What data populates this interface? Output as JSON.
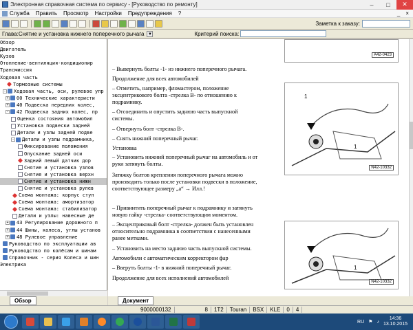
{
  "window": {
    "title": "Электронная справочная система по сервису - [Руководство по ремонту]"
  },
  "menu": {
    "items": [
      "Служба",
      "Править",
      "Просмотр",
      "Настройки",
      "Предупреждения",
      "?"
    ],
    "right": [
      "_",
      "×"
    ]
  },
  "toolbar": {
    "order_label": "Заметка к заказу:"
  },
  "chapter": {
    "label": "Глава:",
    "value": "Снятие и установка нижнего поперечного рычага",
    "criteria_label": "Критерий поиска:"
  },
  "tree": [
    {
      "text": "Обзор",
      "icon": "none",
      "exp": ""
    },
    {
      "text": "Двигатель",
      "icon": "none",
      "exp": ""
    },
    {
      "text": "Кузов",
      "icon": "none",
      "exp": ""
    },
    {
      "text": "Отопление-вентиляция-кондиционир",
      "icon": "none",
      "exp": ""
    },
    {
      "text": "Трансмиссия",
      "icon": "none",
      "exp": ""
    },
    {
      "text": "Ходовая часть",
      "icon": "none",
      "exp": ""
    },
    {
      "text": "Тормозные системы",
      "icon": "diamond",
      "exp": ""
    },
    {
      "text": "Ходовая часть, оси, рулевое упр",
      "icon": "book",
      "exp": "-"
    },
    {
      "text": "00 Технические характеристи",
      "icon": "book",
      "exp": "+"
    },
    {
      "text": "40 Подвеска передних колес,",
      "icon": "book",
      "exp": "+"
    },
    {
      "text": "42 Подвеска задних колес, пр",
      "icon": "book",
      "exp": "-"
    },
    {
      "text": "Оценка состояния автомобил",
      "icon": "page",
      "exp": ""
    },
    {
      "text": "Установка подвески задней",
      "icon": "page",
      "exp": ""
    },
    {
      "text": "Детали и узлы задней подве",
      "icon": "page",
      "exp": ""
    },
    {
      "text": "Детали и узлы подрамника,",
      "icon": "book",
      "exp": "-"
    },
    {
      "text": "Фиксирование положения",
      "icon": "page",
      "exp": ""
    },
    {
      "text": "Опускание задней оси",
      "icon": "page",
      "exp": ""
    },
    {
      "text": "Задний левый датчик дор",
      "icon": "diamond",
      "exp": ""
    },
    {
      "text": "Снятие и установка узлов",
      "icon": "page",
      "exp": ""
    },
    {
      "text": "Снятие и установка верхн",
      "icon": "page",
      "exp": ""
    },
    {
      "text": "Снятие и установка нижн",
      "icon": "page",
      "exp": "",
      "selected": true
    },
    {
      "text": "Снятие и установка рулев",
      "icon": "page",
      "exp": ""
    },
    {
      "text": "Схема монтажа: корпус ступ",
      "icon": "diamond",
      "exp": ""
    },
    {
      "text": "Схема монтажа: амортизатор",
      "icon": "diamond",
      "exp": ""
    },
    {
      "text": "Схема монтажа: стабилизатор",
      "icon": "diamond",
      "exp": ""
    },
    {
      "text": "Детали и узлы: навесные де",
      "icon": "page",
      "exp": ""
    },
    {
      "text": "43 Регулирование дорожного п",
      "icon": "book",
      "exp": "+"
    },
    {
      "text": "44 Шины, колеса, углы установ",
      "icon": "book",
      "exp": "+"
    },
    {
      "text": "48 Рулевое управление",
      "icon": "book",
      "exp": "+"
    },
    {
      "text": "Руководство по эксплуатации ав",
      "icon": "book",
      "exp": ""
    },
    {
      "text": "Руководство по колёсам и шинам",
      "icon": "book",
      "exp": ""
    },
    {
      "text": "Справочник - серия Колеса и шин",
      "icon": "book",
      "exp": ""
    },
    {
      "text": "Электрика",
      "icon": "none",
      "exp": ""
    }
  ],
  "tabs": {
    "left": "Обзор",
    "doc": "Документ"
  },
  "doc": {
    "lines": [
      "–  Вывернуть болты -1- из нижнего поперечного рычага.",
      "Продолжение для всех автомобилей",
      "–  Отметить, например, фломастером, положение",
      "    эксцентрикового болта -стрелка В- по отношению к",
      "    подрамнику.",
      "–  Отсоединить и опустить заднюю часть выпускной",
      "    системы.",
      "–  Отвернуть болт -стрелка В-.",
      "–  Снять нижний поперечный рычаг.",
      "Установка",
      "–  Установить нижний поперечный рычаг на автомобиль и от",
      "    руки затянуть болты.",
      "Затяжку болтов крепления поперечного рычага можно",
      "производить только после установки подвески в положение,",
      "соответствующее размеру „a“ → Илл.!",
      "–  Привинтить поперечный рычаг к подрамнику и затянуть",
      "    новую гайку -стрелка- соответствующим моментом.",
      "–  Эксцентриковый болт -стрелка- должен быть установлен",
      "    относительно подрамника в соответствии с нанесенными",
      "    ранее метками.",
      "–  Установить на место заднюю часть выпускной системы.",
      "Автомобили с автоматическим корректором фар",
      "–  Вверуть болты -1- в нижний поперечный рычаг.",
      "Продолжение для всех исполнений автомобилей"
    ]
  },
  "figures": [
    {
      "label": "A42-0423"
    },
    {
      "label": "N42-10332"
    },
    {
      "label": "N42-10332"
    }
  ],
  "status": [
    "9000000132",
    "8",
    "1T2",
    "Touran",
    "BSX",
    "KLE",
    "0",
    "4"
  ],
  "tray": {
    "lang": "RU",
    "time": "14:36",
    "date": "13.10.2015"
  }
}
